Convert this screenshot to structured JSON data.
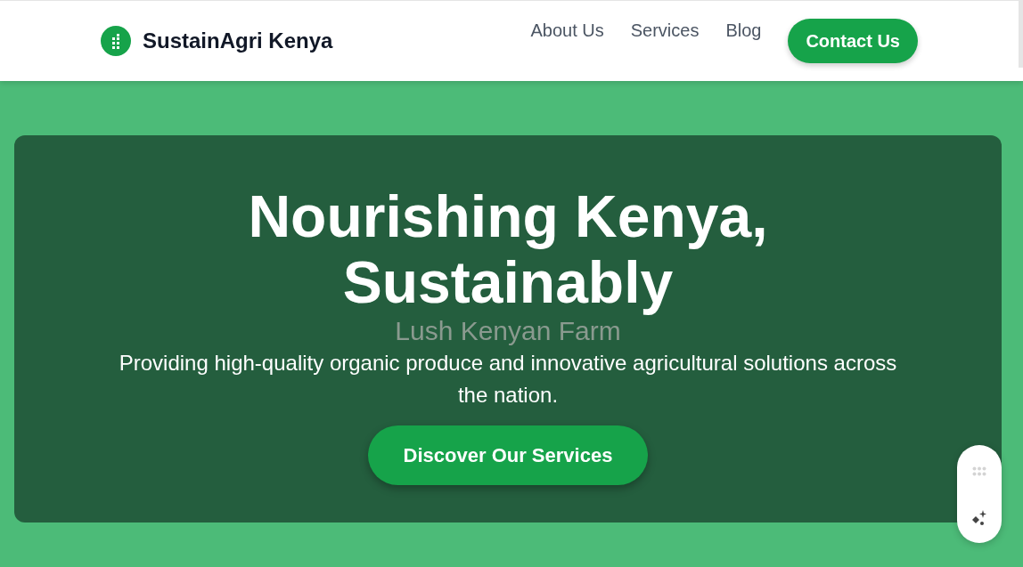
{
  "header": {
    "brand": "SustainAgri Kenya",
    "nav": [
      {
        "label": "About Us"
      },
      {
        "label": "Services"
      },
      {
        "label": "Blog"
      }
    ],
    "cta": "Contact Us"
  },
  "hero": {
    "image_alt": "Lush Kenyan Farm",
    "title": "Nourishing Kenya, Sustainably",
    "subtitle": "Providing high-quality organic produce and innovative agricultural solutions across the nation.",
    "button": "Discover Our Services"
  }
}
